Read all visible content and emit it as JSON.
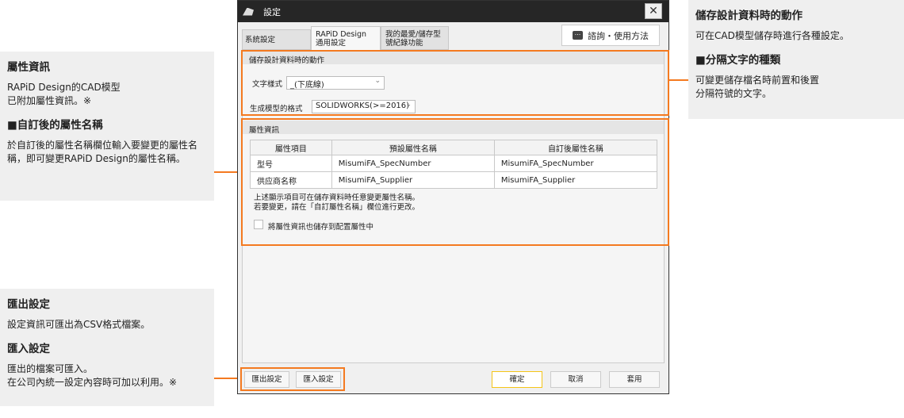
{
  "notes_left": [
    {
      "title": "屬性資訊",
      "text": "RAPiD Design的CAD模型\n已附加屬性資訊。※"
    },
    {
      "title": "■自訂後的屬性名稱",
      "text": "於自訂後的屬性名稱欄位輸入要變更的屬性名稱，即可變更RAPiD Design的屬性名稱。"
    },
    {
      "title": "匯出設定",
      "text": "設定資訊可匯出為CSV格式檔案。"
    },
    {
      "title": "匯入設定",
      "text": "匯出的檔案可匯入。\n在公司內統一設定內容時可加以利用。※"
    }
  ],
  "notes_right": [
    {
      "title": "儲存設計資料時的動作",
      "text": "可在CAD模型儲存時進行各種設定。"
    },
    {
      "title": "■分隔文字的種類",
      "text": "可變更儲存檔名時前置和後置\n分隔符號的文字。"
    }
  ],
  "dialog": {
    "title": "設定",
    "close": "✕",
    "tabs": [
      "系統設定",
      "RAPiD Design\n通用設定",
      "我的最愛/儲存型\n號紀錄功能"
    ],
    "help": "諮詢・使用方法",
    "save_section": {
      "title": "儲存設計資料時的動作",
      "char_label": "文字樣式",
      "char_value": "_(下底線)",
      "format_label": "生成模型的格式",
      "format_value": "SOLIDWORKS(>=2016)"
    },
    "attr_section": {
      "title": "屬性資訊",
      "columns": [
        "屬性項目",
        "預設屬性名稱",
        "自訂後屬性名稱"
      ],
      "rows": [
        [
          "型号",
          "MisumiFA_SpecNumber",
          "MisumiFA_SpecNumber"
        ],
        [
          "供应商名称",
          "MisumiFA_Supplier",
          "MisumiFA_Supplier"
        ]
      ],
      "hint": "上述顯示項目可在儲存資料時任意變更屬性名稱。\n若要變更，請在「自訂屬性名稱」欄位進行更改。",
      "checkbox": "將屬性資訊也儲存到配置屬性中"
    },
    "buttons": {
      "export": "匯出設定",
      "import": "匯入設定",
      "ok": "確定",
      "cancel": "取消",
      "apply": "套用"
    }
  },
  "accent": "#f47a20"
}
